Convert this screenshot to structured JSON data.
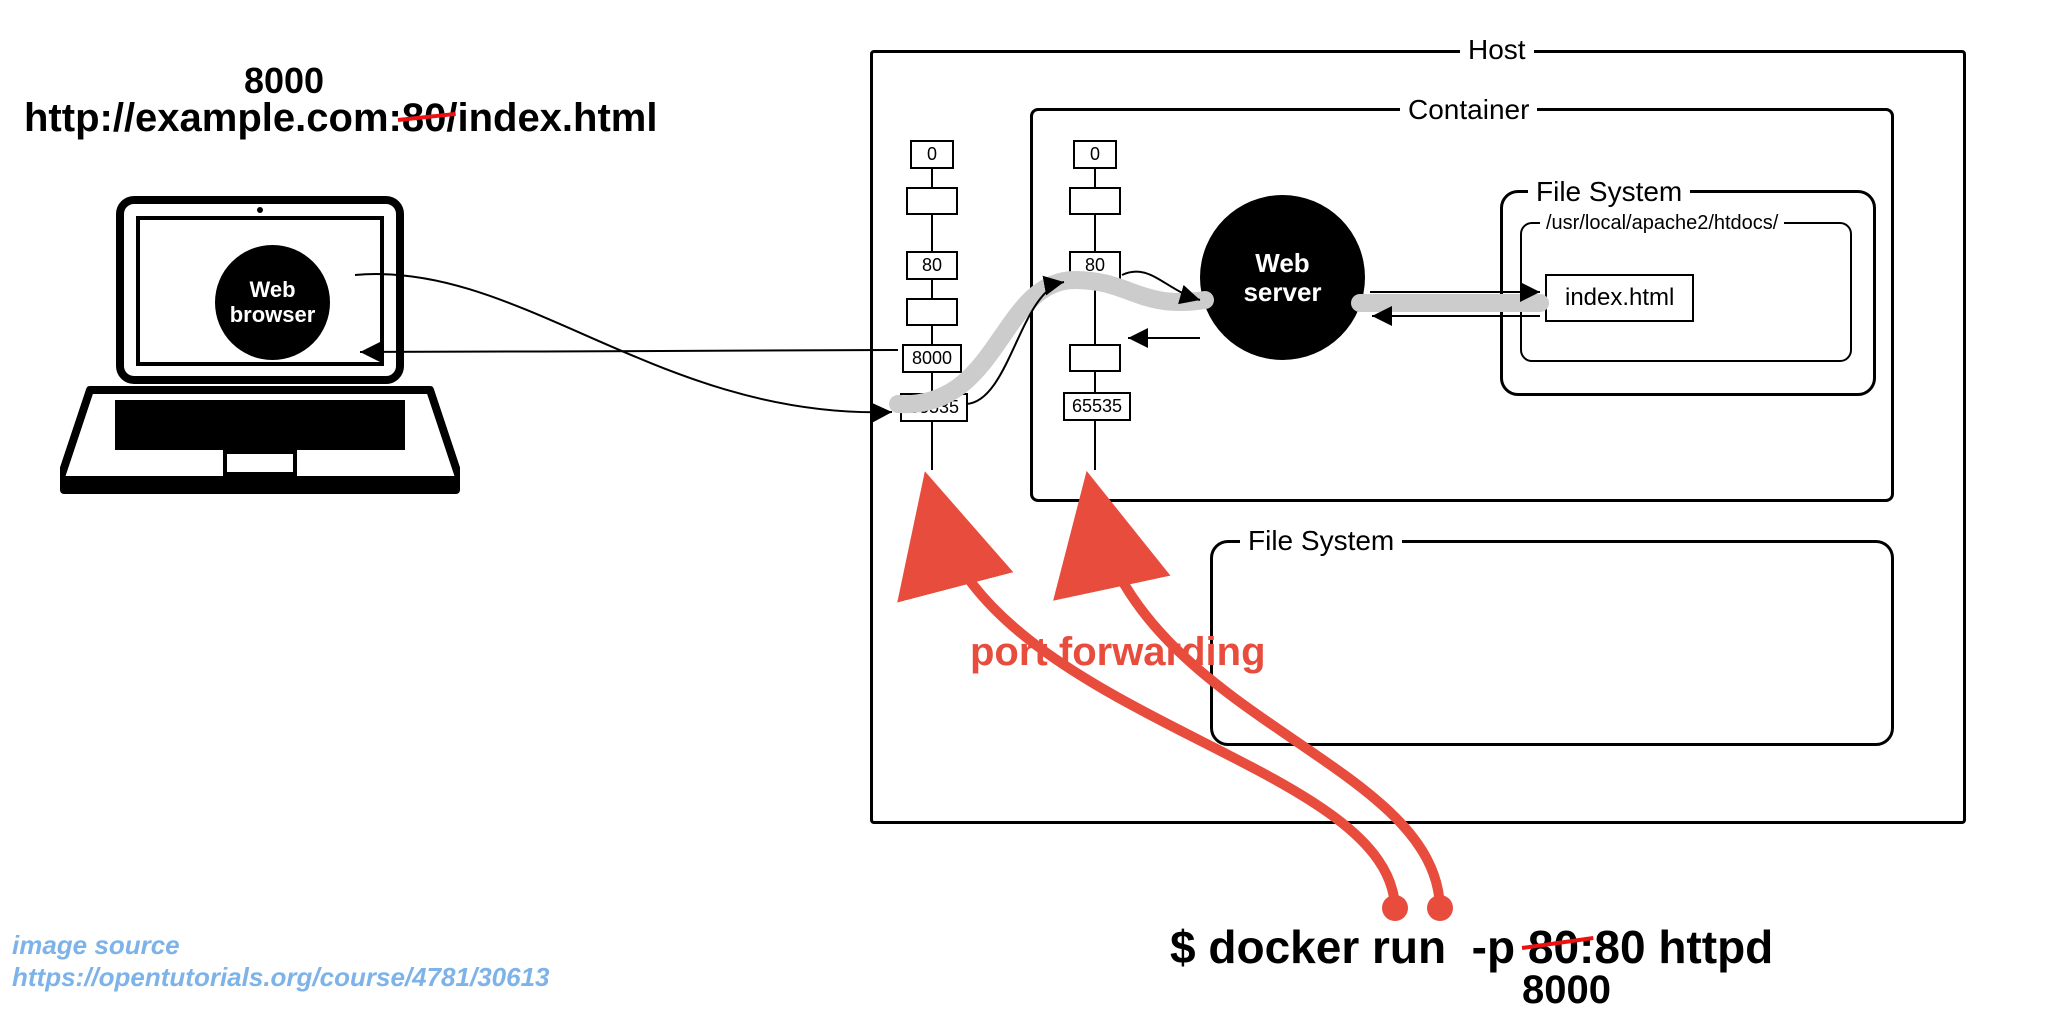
{
  "url_bar": {
    "new_port": "8000",
    "prefix": "http://example.com:",
    "old_port": "80",
    "suffix": "/index.html"
  },
  "laptop": {
    "label": "Web\nbrowser"
  },
  "host": {
    "label": "Host",
    "ports": {
      "p0": "0",
      "p80": "80",
      "p8000": "8000",
      "pmax": "65535"
    },
    "fs_label": "File System"
  },
  "container": {
    "label": "Container",
    "ports": {
      "p0": "0",
      "p80": "80",
      "pmax": "65535"
    },
    "server_label": "Web\nserver",
    "fs_label": "File System",
    "docroot": "/usr/local/apache2/htdocs/",
    "file": "index.html"
  },
  "annotation": {
    "port_forwarding": "port forwarding"
  },
  "command": {
    "prompt": "$ ",
    "cmd1": "docker run ",
    "flag": "-p ",
    "old_port": "80",
    "colon": ":",
    "container_port": "80",
    "img": " httpd",
    "new_port": "8000"
  },
  "watermark": {
    "line1": "image source",
    "line2": "https://opentutorials.org/course/4781/30613"
  }
}
